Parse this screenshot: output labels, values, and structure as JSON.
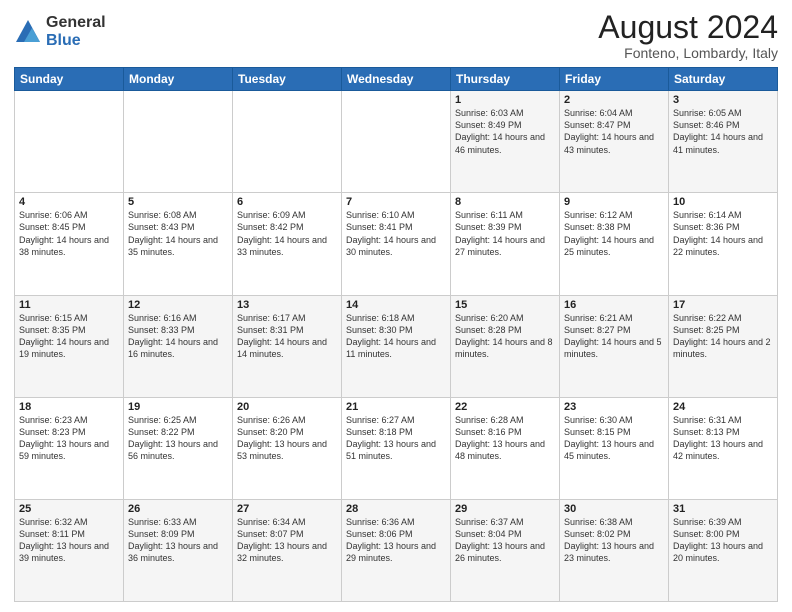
{
  "logo": {
    "general": "General",
    "blue": "Blue"
  },
  "title": "August 2024",
  "subtitle": "Fonteno, Lombardy, Italy",
  "days_of_week": [
    "Sunday",
    "Monday",
    "Tuesday",
    "Wednesday",
    "Thursday",
    "Friday",
    "Saturday"
  ],
  "weeks": [
    [
      {
        "day": "",
        "info": ""
      },
      {
        "day": "",
        "info": ""
      },
      {
        "day": "",
        "info": ""
      },
      {
        "day": "",
        "info": ""
      },
      {
        "day": "1",
        "info": "Sunrise: 6:03 AM\nSunset: 8:49 PM\nDaylight: 14 hours and 46 minutes."
      },
      {
        "day": "2",
        "info": "Sunrise: 6:04 AM\nSunset: 8:47 PM\nDaylight: 14 hours and 43 minutes."
      },
      {
        "day": "3",
        "info": "Sunrise: 6:05 AM\nSunset: 8:46 PM\nDaylight: 14 hours and 41 minutes."
      }
    ],
    [
      {
        "day": "4",
        "info": "Sunrise: 6:06 AM\nSunset: 8:45 PM\nDaylight: 14 hours and 38 minutes."
      },
      {
        "day": "5",
        "info": "Sunrise: 6:08 AM\nSunset: 8:43 PM\nDaylight: 14 hours and 35 minutes."
      },
      {
        "day": "6",
        "info": "Sunrise: 6:09 AM\nSunset: 8:42 PM\nDaylight: 14 hours and 33 minutes."
      },
      {
        "day": "7",
        "info": "Sunrise: 6:10 AM\nSunset: 8:41 PM\nDaylight: 14 hours and 30 minutes."
      },
      {
        "day": "8",
        "info": "Sunrise: 6:11 AM\nSunset: 8:39 PM\nDaylight: 14 hours and 27 minutes."
      },
      {
        "day": "9",
        "info": "Sunrise: 6:12 AM\nSunset: 8:38 PM\nDaylight: 14 hours and 25 minutes."
      },
      {
        "day": "10",
        "info": "Sunrise: 6:14 AM\nSunset: 8:36 PM\nDaylight: 14 hours and 22 minutes."
      }
    ],
    [
      {
        "day": "11",
        "info": "Sunrise: 6:15 AM\nSunset: 8:35 PM\nDaylight: 14 hours and 19 minutes."
      },
      {
        "day": "12",
        "info": "Sunrise: 6:16 AM\nSunset: 8:33 PM\nDaylight: 14 hours and 16 minutes."
      },
      {
        "day": "13",
        "info": "Sunrise: 6:17 AM\nSunset: 8:31 PM\nDaylight: 14 hours and 14 minutes."
      },
      {
        "day": "14",
        "info": "Sunrise: 6:18 AM\nSunset: 8:30 PM\nDaylight: 14 hours and 11 minutes."
      },
      {
        "day": "15",
        "info": "Sunrise: 6:20 AM\nSunset: 8:28 PM\nDaylight: 14 hours and 8 minutes."
      },
      {
        "day": "16",
        "info": "Sunrise: 6:21 AM\nSunset: 8:27 PM\nDaylight: 14 hours and 5 minutes."
      },
      {
        "day": "17",
        "info": "Sunrise: 6:22 AM\nSunset: 8:25 PM\nDaylight: 14 hours and 2 minutes."
      }
    ],
    [
      {
        "day": "18",
        "info": "Sunrise: 6:23 AM\nSunset: 8:23 PM\nDaylight: 13 hours and 59 minutes."
      },
      {
        "day": "19",
        "info": "Sunrise: 6:25 AM\nSunset: 8:22 PM\nDaylight: 13 hours and 56 minutes."
      },
      {
        "day": "20",
        "info": "Sunrise: 6:26 AM\nSunset: 8:20 PM\nDaylight: 13 hours and 53 minutes."
      },
      {
        "day": "21",
        "info": "Sunrise: 6:27 AM\nSunset: 8:18 PM\nDaylight: 13 hours and 51 minutes."
      },
      {
        "day": "22",
        "info": "Sunrise: 6:28 AM\nSunset: 8:16 PM\nDaylight: 13 hours and 48 minutes."
      },
      {
        "day": "23",
        "info": "Sunrise: 6:30 AM\nSunset: 8:15 PM\nDaylight: 13 hours and 45 minutes."
      },
      {
        "day": "24",
        "info": "Sunrise: 6:31 AM\nSunset: 8:13 PM\nDaylight: 13 hours and 42 minutes."
      }
    ],
    [
      {
        "day": "25",
        "info": "Sunrise: 6:32 AM\nSunset: 8:11 PM\nDaylight: 13 hours and 39 minutes."
      },
      {
        "day": "26",
        "info": "Sunrise: 6:33 AM\nSunset: 8:09 PM\nDaylight: 13 hours and 36 minutes."
      },
      {
        "day": "27",
        "info": "Sunrise: 6:34 AM\nSunset: 8:07 PM\nDaylight: 13 hours and 32 minutes."
      },
      {
        "day": "28",
        "info": "Sunrise: 6:36 AM\nSunset: 8:06 PM\nDaylight: 13 hours and 29 minutes."
      },
      {
        "day": "29",
        "info": "Sunrise: 6:37 AM\nSunset: 8:04 PM\nDaylight: 13 hours and 26 minutes."
      },
      {
        "day": "30",
        "info": "Sunrise: 6:38 AM\nSunset: 8:02 PM\nDaylight: 13 hours and 23 minutes."
      },
      {
        "day": "31",
        "info": "Sunrise: 6:39 AM\nSunset: 8:00 PM\nDaylight: 13 hours and 20 minutes."
      }
    ]
  ]
}
